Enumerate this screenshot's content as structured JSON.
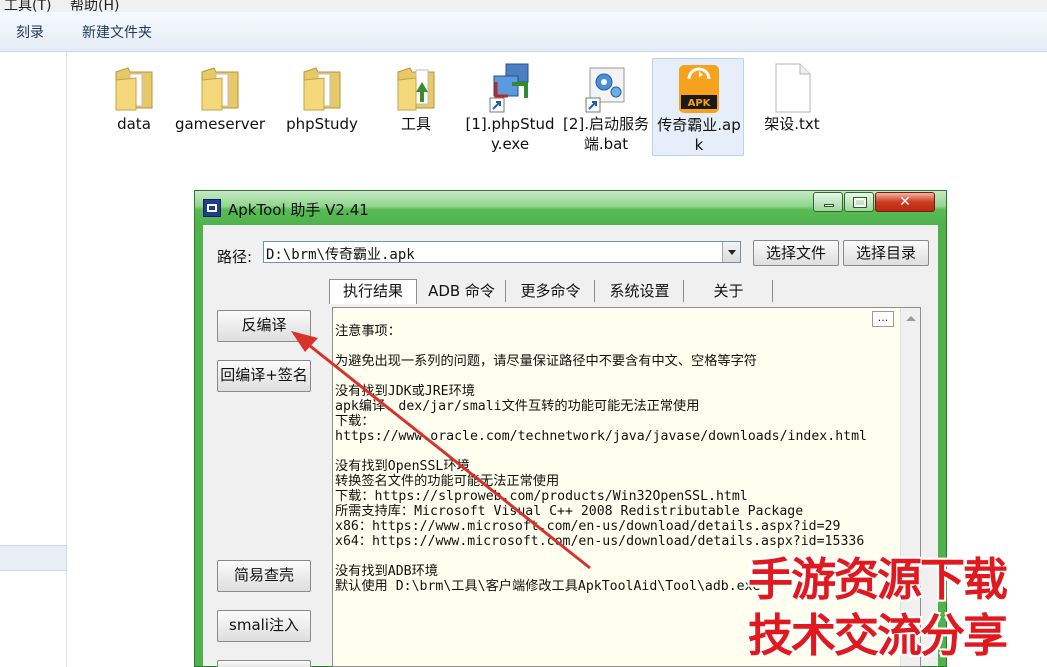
{
  "menubar": {
    "items": [
      "工具(T)",
      "帮助(H)"
    ]
  },
  "toolbar": {
    "burn": "刻录",
    "new_folder": "新建文件夹"
  },
  "files": [
    {
      "name": "data",
      "icon": "folder-icon"
    },
    {
      "name": "gameserver",
      "icon": "folder-icon"
    },
    {
      "name": "phpStudy",
      "icon": "folder-icon"
    },
    {
      "name": "工具",
      "icon": "folder-icon"
    },
    {
      "name": "[1].phpStudy.exe",
      "icon": "app-shortcut-icon"
    },
    {
      "name": "[2].启动服务端.bat",
      "icon": "gear-shortcut-icon"
    },
    {
      "name": "传奇霸业.apk",
      "icon": "apk-icon",
      "selected": true,
      "badge": "APK"
    },
    {
      "name": "架设.txt",
      "icon": "text-file-icon"
    }
  ],
  "window": {
    "title": "ApkTool 助手 V2.41",
    "path_label": "路径:",
    "path_value": "D:\\brm\\传奇霸业.apk",
    "select_file": "选择文件",
    "select_dir": "选择目录",
    "tabs": [
      "执行结果",
      "ADB 命令",
      "更多命令",
      "系统设置",
      "关于"
    ],
    "active_tab": "执行结果",
    "side_buttons": [
      "反编译",
      "回编译+签名",
      "简易查壳",
      "smali注入"
    ],
    "results": {
      "more": "...",
      "lines": [
        "注意事项：",
        "",
        "为避免出现一系列的问题，请尽量保证路径中不要含有中文、空格等字符",
        "",
        "没有找到JDK或JRE环境",
        "apk编译、dex/jar/smali文件互转的功能可能无法正常使用",
        "下载：",
        "https://www.oracle.com/technetwork/java/javase/downloads/index.html",
        "",
        "没有找到OpenSSL环境",
        "转换签名文件的功能可能无法正常使用",
        "下载：https://slproweb.com/products/Win32OpenSSL.html",
        "所需支持库：Microsoft Visual C++ 2008 Redistributable Package",
        "x86：https://www.microsoft.com/en-us/download/details.aspx?id=29",
        "x64：https://www.microsoft.com/en-us/download/details.aspx?id=15336",
        "",
        "没有找到ADB环境",
        "默认使用 D:\\brm\\工具\\客户端修改工具ApkToolAid\\Tool\\adb.exe"
      ]
    }
  },
  "watermark": {
    "line1": "手游资源下载",
    "line2": "技术交流分享"
  },
  "colors": {
    "window_frame": "#4fb24c",
    "watermark": "#e1191e",
    "arrow": "#d9312c",
    "results_bg": "#fffff0"
  }
}
